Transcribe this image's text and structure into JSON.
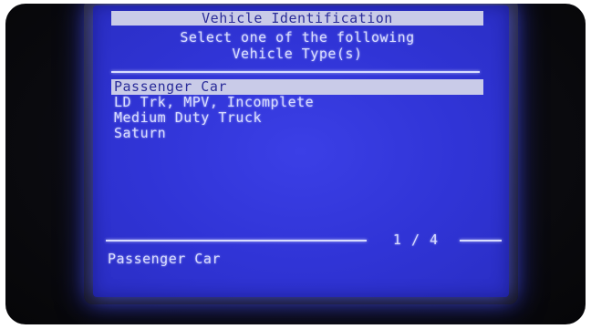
{
  "header": {
    "title": "Vehicle Identification",
    "line1": "Select one of the following",
    "line2": "Vehicle Type(s)"
  },
  "list": {
    "selected_index": 0,
    "items": [
      {
        "label": "Passenger Car"
      },
      {
        "label": "LD Trk, MPV, Incomplete"
      },
      {
        "label": "Medium Duty Truck"
      },
      {
        "label": "Saturn"
      }
    ]
  },
  "footer": {
    "page_indicator": "1 / 4",
    "status_text": "Passenger Car"
  },
  "colors": {
    "screen_bg": "#3034d6",
    "highlight_bg": "#c9cbe8",
    "text": "#d8dcff",
    "highlight_text": "#2b2d9a"
  }
}
